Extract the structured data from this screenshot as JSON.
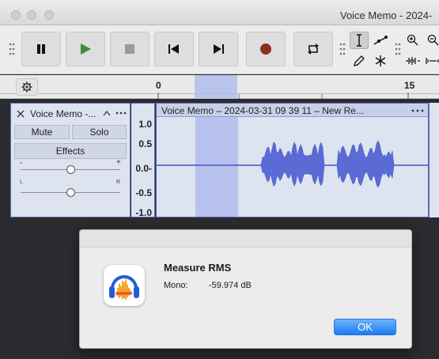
{
  "window": {
    "title": "Voice Memo - 2024-"
  },
  "ruler": {
    "ticks": [
      "0",
      "15"
    ]
  },
  "track": {
    "name": "Voice Memo -...",
    "mute_label": "Mute",
    "solo_label": "Solo",
    "effects_label": "Effects",
    "gain_min": "-",
    "gain_max": "+",
    "pan_left": "L",
    "pan_right": "R",
    "scale": [
      "1.0",
      "0.5",
      "0.0-",
      "-0.5",
      "-1.0"
    ],
    "clip_title": "Voice Memo – 2024-03-31 09 39 11 – New Re..."
  },
  "dialog": {
    "title": "Measure RMS",
    "label": "Mono:",
    "value": "-59.974 dB",
    "ok_label": "OK"
  }
}
